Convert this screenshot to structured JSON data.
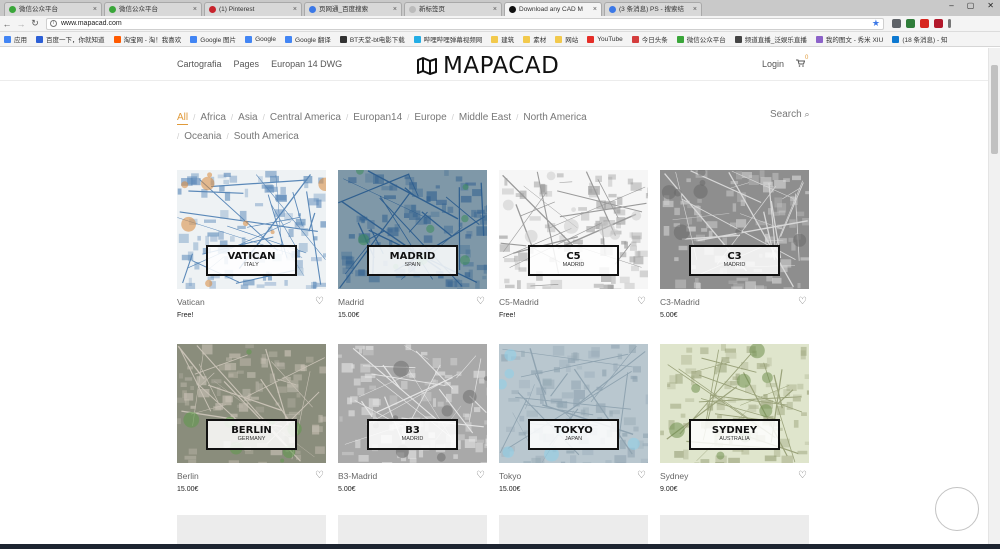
{
  "browser": {
    "tabs": [
      {
        "label": "微信公众平台",
        "favicon_color": "#3aa63a"
      },
      {
        "label": "微信公众平台",
        "favicon_color": "#3aa63a"
      },
      {
        "label": "(1) Pinterest",
        "favicon_color": "#c8232c"
      },
      {
        "label": "页网通_百度搜索",
        "favicon_color": "#3b78e7"
      },
      {
        "label": "新标签页",
        "favicon_color": "#bbbbbb"
      },
      {
        "label": "Download any CAD M",
        "favicon_color": "#111111",
        "active": true
      },
      {
        "label": "(3 条消息) PS - 搜索结",
        "favicon_color": "#3b78e7"
      }
    ],
    "window_controls": [
      "–",
      "▢",
      "✕"
    ],
    "url": "www.mapacad.com",
    "back_icon": "←",
    "forward_icon": "→",
    "reload_icon": "↻",
    "bookmarks": [
      {
        "label": "应用",
        "color": "#4285f4"
      },
      {
        "label": "百度一下，你就知道",
        "color": "#2c5fd6"
      },
      {
        "label": "淘宝网 - 淘！我喜欢",
        "color": "#ff5a00"
      },
      {
        "label": "Google 图片",
        "color": "#4285f4"
      },
      {
        "label": "Google",
        "color": "#4285f4"
      },
      {
        "label": "Google 翻译",
        "color": "#4285f4"
      },
      {
        "label": "BT天堂-bt电影下载",
        "color": "#333333"
      },
      {
        "label": "哔哩哔哩弹幕视频网",
        "color": "#23ade5"
      },
      {
        "label": "建筑",
        "color": "#f2c94c"
      },
      {
        "label": "素材",
        "color": "#f2c94c"
      },
      {
        "label": "网站",
        "color": "#f2c94c"
      },
      {
        "label": "YouTube",
        "color": "#e52d27"
      },
      {
        "label": "今日头条",
        "color": "#d43d3d"
      },
      {
        "label": "微信公众平台",
        "color": "#3aa63a"
      },
      {
        "label": "频道直播_泛娱乐直播",
        "color": "#444444"
      },
      {
        "label": "我的图文 - 秀米 XIU",
        "color": "#8c62c9"
      },
      {
        "label": "(18 条消息) - 知",
        "color": "#0d79d1"
      }
    ]
  },
  "header": {
    "nav_left": [
      "Cartografia",
      "Pages",
      "Europan 14 DWG"
    ],
    "logo": "MAPACAD",
    "login": "Login",
    "cart_count": "0"
  },
  "filters": {
    "items": [
      "All",
      "Africa",
      "Asia",
      "Central America",
      "Europan14",
      "Europe",
      "Middle East",
      "North America",
      "Oceania",
      "South America"
    ],
    "active": "All",
    "search_label": "Search"
  },
  "products": [
    {
      "name": "Vatican",
      "price": "Free!",
      "city": "VATICAN",
      "country": "ITALY",
      "bg": "#eef2f4",
      "road": "#5a88b8",
      "accent": "#d9883a"
    },
    {
      "name": "Madrid",
      "price": "15.00€",
      "city": "MADRID",
      "country": "SPAIN",
      "bg": "#7f98a8",
      "road": "#2f5f8f",
      "accent": "#3d8c5a"
    },
    {
      "name": "C5-Madrid",
      "price": "Free!",
      "city": "C5",
      "country": "MADRID",
      "bg": "#f6f6f6",
      "road": "#9a9a9a",
      "accent": "#cccccc"
    },
    {
      "name": "C3-Madrid",
      "price": "5.00€",
      "city": "C3",
      "country": "MADRID",
      "bg": "#8e8e8e",
      "road": "#d8d8d8",
      "accent": "#6a6a6a"
    },
    {
      "name": "Berlin",
      "price": "15.00€",
      "city": "BERLIN",
      "country": "GERMANY",
      "bg": "#8a8d7c",
      "road": "#c9c2b6",
      "accent": "#5e9a4a"
    },
    {
      "name": "B3-Madrid",
      "price": "5.00€",
      "city": "B3",
      "country": "MADRID",
      "bg": "#a9a9a9",
      "road": "#e5e5e5",
      "accent": "#6f6f6f"
    },
    {
      "name": "Tokyo",
      "price": "15.00€",
      "city": "TOKYO",
      "country": "JAPAN",
      "bg": "#b9c7cf",
      "road": "#8fa3b0",
      "accent": "#8ed0ea"
    },
    {
      "name": "Sydney",
      "price": "9.00€",
      "city": "SYDNEY",
      "country": "AUSTRALIA",
      "bg": "#dfe5cc",
      "road": "#9aa27a",
      "accent": "#6f8f4e"
    }
  ],
  "placeholders_count": 4,
  "icons": {
    "logo": "folded-map-icon",
    "heart": "heart-icon",
    "cart": "cart-icon",
    "search": "search-icon"
  }
}
